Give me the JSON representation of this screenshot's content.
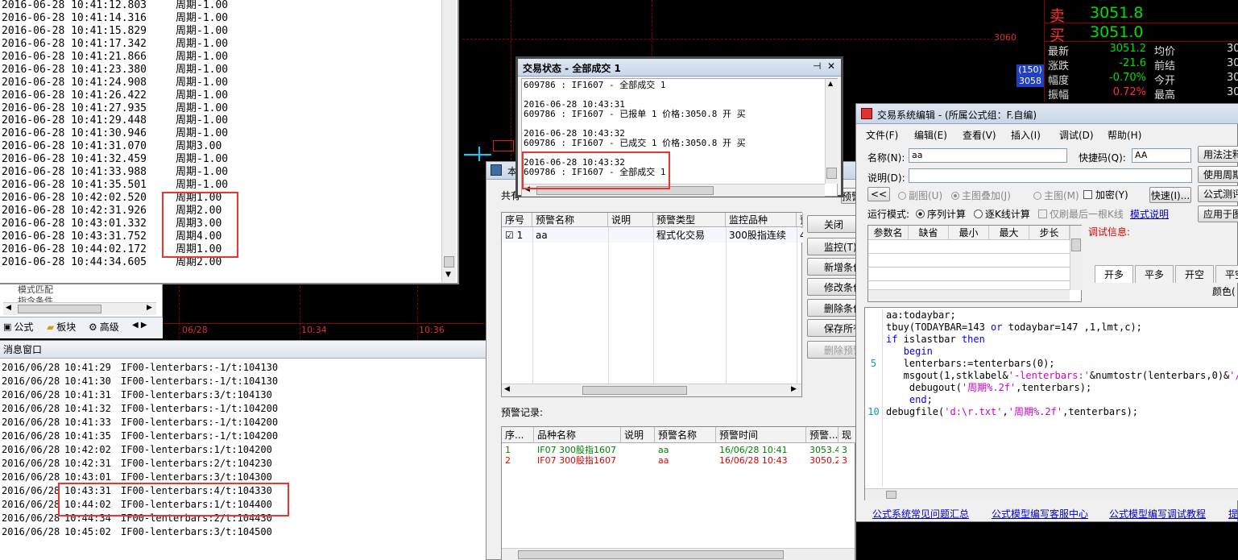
{
  "debug_log": {
    "lines": [
      {
        "ts": "2016-06-28 10:41:12.803",
        "msg": "周期-1.00"
      },
      {
        "ts": "2016-06-28 10:41:14.316",
        "msg": "周期-1.00"
      },
      {
        "ts": "2016-06-28 10:41:15.829",
        "msg": "周期-1.00"
      },
      {
        "ts": "2016-06-28 10:41:17.342",
        "msg": "周期-1.00"
      },
      {
        "ts": "2016-06-28 10:41:21.866",
        "msg": "周期-1.00"
      },
      {
        "ts": "2016-06-28 10:41:23.380",
        "msg": "周期-1.00"
      },
      {
        "ts": "2016-06-28 10:41:24.908",
        "msg": "周期-1.00"
      },
      {
        "ts": "2016-06-28 10:41:26.422",
        "msg": "周期-1.00"
      },
      {
        "ts": "2016-06-28 10:41:27.935",
        "msg": "周期-1.00"
      },
      {
        "ts": "2016-06-28 10:41:29.448",
        "msg": "周期-1.00"
      },
      {
        "ts": "2016-06-28 10:41:30.946",
        "msg": "周期-1.00"
      },
      {
        "ts": "2016-06-28 10:41:31.070",
        "msg": "周期3.00"
      },
      {
        "ts": "2016-06-28 10:41:32.459",
        "msg": "周期-1.00"
      },
      {
        "ts": "2016-06-28 10:41:33.988",
        "msg": "周期-1.00"
      },
      {
        "ts": "2016-06-28 10:41:35.501",
        "msg": "周期-1.00"
      },
      {
        "ts": "2016-06-28 10:42:02.520",
        "msg": "周期1.00"
      },
      {
        "ts": "2016-06-28 10:42:31.926",
        "msg": "周期2.00"
      },
      {
        "ts": "2016-06-28 10:43:01.332",
        "msg": "周期3.00"
      },
      {
        "ts": "2016-06-28 10:43:31.752",
        "msg": "周期4.00"
      },
      {
        "ts": "2016-06-28 10:44:02.172",
        "msg": "周期1.00"
      },
      {
        "ts": "2016-06-28 10:44:34.605",
        "msg": "周期2.00"
      }
    ]
  },
  "left_panel": {
    "partial_items": [
      "模式匹配",
      "指令条件"
    ],
    "tabs": [
      "公式",
      "板块",
      "高级"
    ]
  },
  "chart": {
    "price_tick": "3060",
    "left_badge": "(150)",
    "left_price": "3058",
    "time_labels": [
      "06/28",
      "10:34",
      "10:36"
    ]
  },
  "quote": {
    "sell_label": "卖",
    "sell_price": "3051.8",
    "buy_label": "买",
    "buy_price": "3051.0",
    "rows": [
      {
        "label": "最新",
        "value": "3051.2",
        "label2": "均价",
        "value2": "30"
      },
      {
        "label": "涨跌",
        "value": "-21.6",
        "label2": "前结",
        "value2": "30"
      },
      {
        "label": "幅度",
        "value": "-0.70%",
        "label2": "今开",
        "value2": "30"
      },
      {
        "label": "振幅",
        "value": "0.72%",
        "label2": "最高",
        "value2": "30"
      }
    ]
  },
  "messages": {
    "title": "消息窗口",
    "lines": [
      {
        "date": "2016/06/28",
        "time": "10:41:29",
        "text": "IF00-lenterbars:-1/t:104130"
      },
      {
        "date": "2016/06/28",
        "time": "10:41:30",
        "text": "IF00-lenterbars:-1/t:104130"
      },
      {
        "date": "2016/06/28",
        "time": "10:41:31",
        "text": "IF00-lenterbars:3/t:104130"
      },
      {
        "date": "2016/06/28",
        "time": "10:41:32",
        "text": "IF00-lenterbars:-1/t:104200"
      },
      {
        "date": "2016/06/28",
        "time": "10:41:33",
        "text": "IF00-lenterbars:-1/t:104200"
      },
      {
        "date": "2016/06/28",
        "time": "10:41:35",
        "text": "IF00-lenterbars:-1/t:104200"
      },
      {
        "date": "2016/06/28",
        "time": "10:42:02",
        "text": "IF00-lenterbars:1/t:104200"
      },
      {
        "date": "2016/06/28",
        "time": "10:42:31",
        "text": "IF00-lenterbars:2/t:104230"
      },
      {
        "date": "2016/06/28",
        "time": "10:43:01",
        "text": "IF00-lenterbars:3/t:104300"
      },
      {
        "date": "2016/06/28",
        "time": "10:43:31",
        "text": "IF00-lenterbars:4/t:104330"
      },
      {
        "date": "2016/06/28",
        "time": "10:44:02",
        "text": "IF00-lenterbars:1/t:104400"
      },
      {
        "date": "2016/06/28",
        "time": "10:44:34",
        "text": "IF00-lenterbars:2/t:104430"
      },
      {
        "date": "2016/06/28",
        "time": "10:45:02",
        "text": "IF00-lenterbars:3/t:104500"
      }
    ]
  },
  "trade_status": {
    "title": "交易状态 - 全部成交 1",
    "pin": "⊣",
    "close": "✕",
    "lines": [
      "609786 : IF1607 - 全部成交 1",
      "",
      "2016-06-28 10:43:31",
      "609786 : IF1607 - 已报单 1 价格:3050.8 开 买",
      "",
      "2016-06-28 10:43:32",
      "609786 : IF1607 - 已成交 1 价格:3050.8 开 买",
      "",
      "2016-06-28 10:43:32",
      "609786 : IF1607 - 全部成交 1"
    ]
  },
  "alert_window": {
    "title_partial": "本",
    "shared_label": "共有",
    "headers": [
      "序号",
      "预警名称",
      "说明",
      "预警类型",
      "监控品种",
      "预"
    ],
    "rows": [
      {
        "check": "☑",
        "no": "1",
        "name": "aa",
        "desc": "",
        "type": "程式化交易",
        "symbol": "300股指连续",
        "extra": "4"
      }
    ],
    "buttons": [
      "关闭",
      "监控(T)",
      "新增条件",
      "修改条件",
      "删除条件",
      "保存所有配",
      "删除预警"
    ],
    "partial_top_button": "预警",
    "records_label": "预警记录:",
    "record_headers": [
      "序...",
      "品种名称",
      "说明",
      "预警名称",
      "预警时间",
      "预警...",
      "现"
    ],
    "records": [
      {
        "no": "1",
        "symbol": "IF07 300股指1607",
        "desc": "",
        "name": "aa",
        "time": "16/06/28 10:41",
        "price": "3053.4",
        "extra": "3",
        "color": "#008000"
      },
      {
        "no": "2",
        "symbol": "IF07 300股指1607",
        "desc": "",
        "name": "aa",
        "time": "16/06/28 10:43",
        "price": "3050.2",
        "extra": "3",
        "color": "#e00000"
      }
    ]
  },
  "editor": {
    "title": "交易系统编辑 - (所属公式组：F.自编)",
    "menu": [
      "文件(F)",
      "编辑(E)",
      "查看(V)",
      "插入(I)",
      "调试(D)",
      "帮助(H)"
    ],
    "name_label": "名称(N):",
    "name_value": "aa",
    "shortcut_label": "快捷码(Q):",
    "shortcut_value": "AA",
    "desc_label": "说明(D):",
    "desc_value": "",
    "right_buttons": [
      "用法注释",
      "使用周期",
      "公式测评",
      "应用于图"
    ],
    "radio_row": [
      "副图(U)",
      "主图叠加(J)",
      "主图(M)"
    ],
    "encrypt_label": "加密(Y)",
    "fast_label": "快速(I)...",
    "back_btn": "<<",
    "run_mode_label": "运行模式:",
    "run_options": [
      "序列计算",
      "逐K线计算"
    ],
    "only_last": "仅刷最后一根K线",
    "mode_link": "模式说明",
    "param_headers": [
      "参数名",
      "缺省",
      "最小",
      "最大",
      "步长"
    ],
    "debug_label": "调试信息:",
    "signal_tabs": [
      "开多",
      "平多",
      "开空",
      "平空"
    ],
    "color_label": "颜色(",
    "gutter": [
      "",
      "",
      "",
      "",
      "5",
      "",
      "",
      "",
      "10"
    ],
    "links": [
      "公式系统常见问题汇总",
      "公式模型编写客服中心",
      "公式模型编写调试教程",
      "提"
    ]
  },
  "colors": {
    "red_highlight": "#e33333",
    "quote_green": "#00e000",
    "quote_red": "#ff3030",
    "chart_bg": "#000000"
  }
}
